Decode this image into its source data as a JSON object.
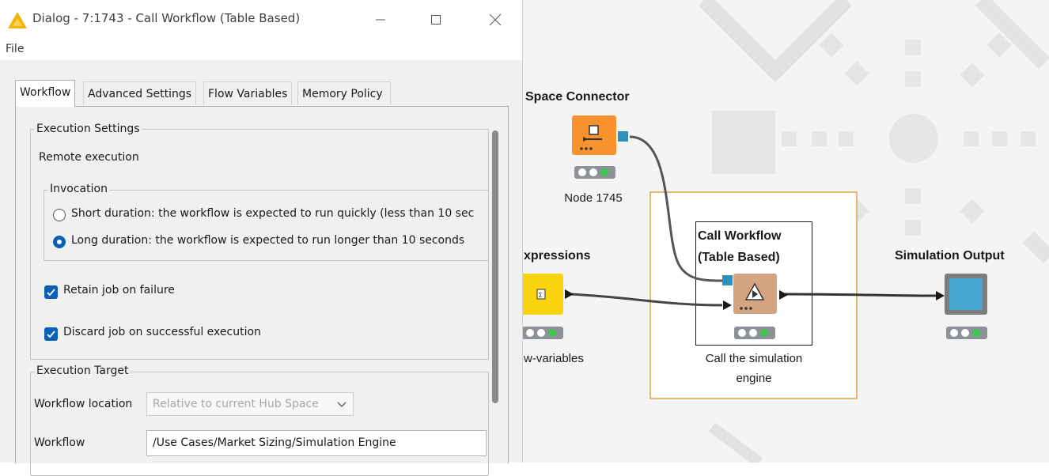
{
  "dialog": {
    "title": "Dialog - 7:1743 - Call Workflow (Table Based)",
    "menu": {
      "file": "File"
    },
    "tabs": [
      "Workflow",
      "Advanced Settings",
      "Flow Variables",
      "Memory Policy"
    ],
    "active_tab": "Workflow",
    "execution_settings": {
      "legend": "Execution Settings",
      "remote_execution": "Remote execution",
      "invocation": {
        "legend": "Invocation",
        "short_label": "Short duration: the workflow is expected to run quickly (less than 10 sec",
        "long_label": "Long duration: the workflow is expected to run longer than 10 seconds",
        "selected": "long"
      },
      "retain_job_label": "Retain job on failure",
      "retain_job_checked": true,
      "discard_job_label": "Discard job on successful execution",
      "discard_job_checked": true
    },
    "execution_target": {
      "legend": "Execution Target",
      "location_label": "Workflow location",
      "location_value": "Relative to current Hub Space",
      "workflow_label": "Workflow",
      "workflow_value": "/Use Cases/Market Sizing/Simulation Engine"
    }
  },
  "canvas": {
    "nodes": {
      "space_connector": {
        "title": "Space Connector",
        "label": "Node 1745",
        "color": "#f7922c"
      },
      "expressions": {
        "title": "xpressions",
        "label": "w-variables",
        "color": "#f9d30c"
      },
      "call_workflow": {
        "title_line1": "Call Workflow",
        "title_line2": "(Table Based)",
        "label_line1": "Call the simulation",
        "label_line2": "engine",
        "color": "#d4a37f"
      },
      "simulation_output": {
        "title": "Simulation Output",
        "color": "#46a6d2"
      }
    },
    "annotation_border_color": "#eab86a"
  }
}
